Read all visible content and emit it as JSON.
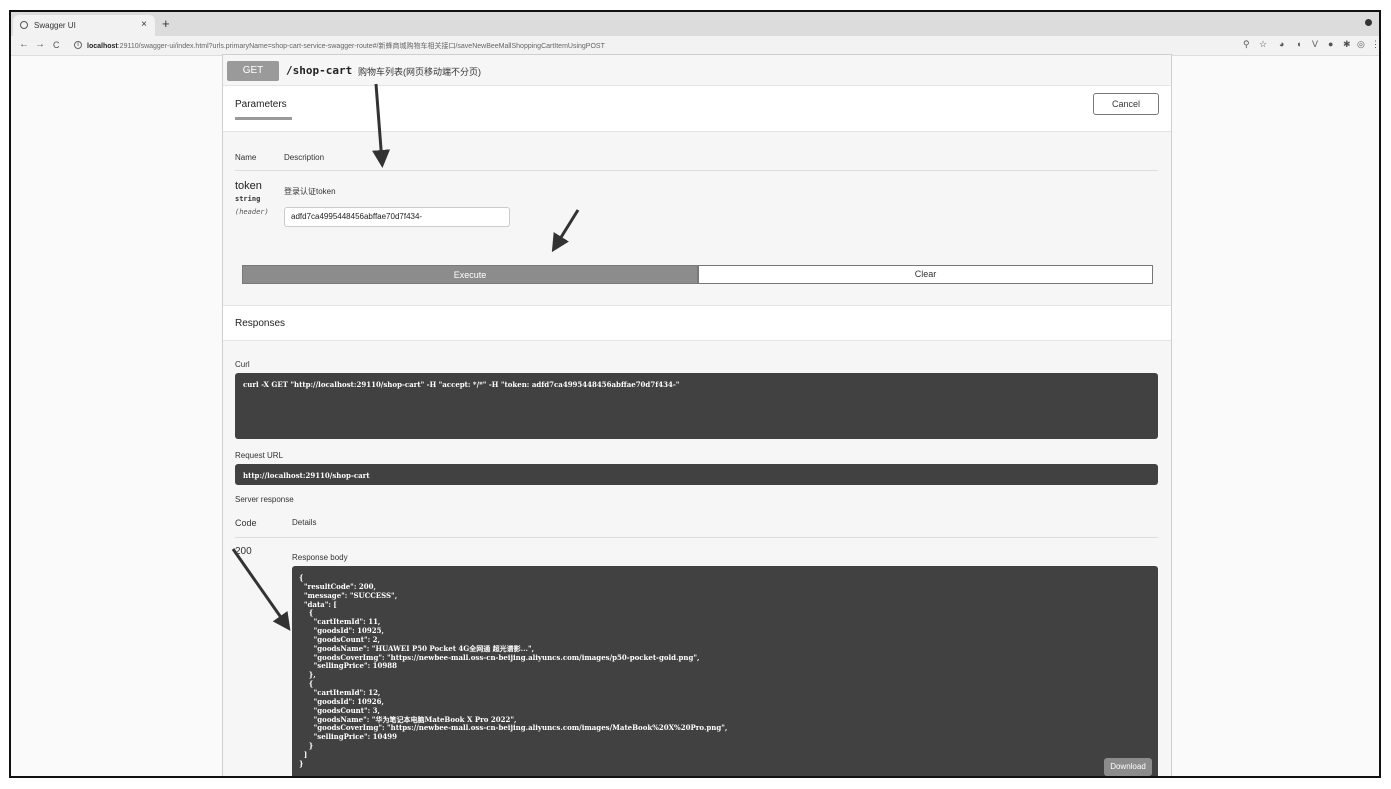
{
  "browser": {
    "tab_title": "Swagger UI",
    "tab_close": "×",
    "new_tab": "+",
    "back": "←",
    "forward": "→",
    "reload": "C",
    "url_host": "localhost",
    "url_rest": ":29110/swagger-ui/index.html?urls.primaryName=shop-cart-service-swagger-route#/新蜂商城购物车相关接口/saveNewBeeMallShoppingCartItemUsingPOST"
  },
  "operation": {
    "method": "GET",
    "path": "/shop-cart",
    "summary": "购物车列表(网页移动端不分页)"
  },
  "parameters": {
    "title": "Parameters",
    "cancel_label": "Cancel",
    "col_name": "Name",
    "col_description": "Description",
    "items": [
      {
        "name": "token",
        "type": "string",
        "in": "(header)",
        "description": "登录认证token",
        "value": "adfd7ca4995448456abffae70d7f434-"
      }
    ]
  },
  "actions": {
    "execute_label": "Execute",
    "clear_label": "Clear"
  },
  "responses": {
    "title": "Responses",
    "curl_label": "Curl",
    "curl_command": "curl -X GET \"http://localhost:29110/shop-cart\" -H \"accept: */*\" -H \"token: adfd7ca4995448456abffae70d7f434-\"",
    "request_url_label": "Request URL",
    "request_url": "http://localhost:29110/shop-cart",
    "server_response_label": "Server response",
    "code_header": "Code",
    "details_header": "Details",
    "code": "200",
    "response_body_label": "Response body",
    "response_body": "{\n  \"resultCode\": 200,\n  \"message\": \"SUCCESS\",\n  \"data\": [\n    {\n      \"cartItemId\": 11,\n      \"goodsId\": 10925,\n      \"goodsCount\": 2,\n      \"goodsName\": \"HUAWEI P50 Pocket 4G全网通 超光谱影...\",\n      \"goodsCoverImg\": \"https://newbee-mall.oss-cn-beijing.aliyuncs.com/images/p50-pocket-gold.png\",\n      \"sellingPrice\": 10988\n    },\n    {\n      \"cartItemId\": 12,\n      \"goodsId\": 10926,\n      \"goodsCount\": 3,\n      \"goodsName\": \"华为笔记本电脑MateBook X Pro 2022\",\n      \"goodsCoverImg\": \"https://newbee-mall.oss-cn-beijing.aliyuncs.com/images/MateBook%20X%20Pro.png\",\n      \"sellingPrice\": 10499\n    }\n  ]\n}",
    "download_label": "Download"
  }
}
